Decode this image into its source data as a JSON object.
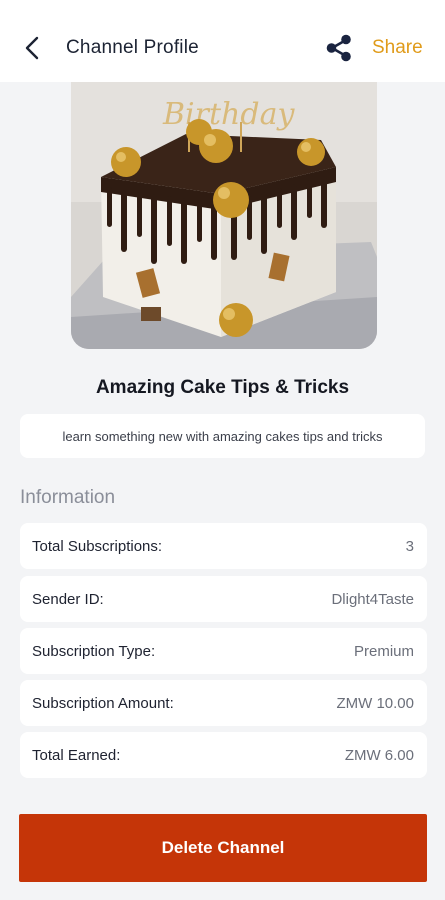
{
  "header": {
    "title": "Channel Profile",
    "share_label": "Share",
    "back_icon": "chevron-left-icon",
    "share_icon": "share-icon",
    "share_color": "#e09b1a"
  },
  "cover": {
    "topper_text": "Birthday",
    "icon": "cake-image"
  },
  "channel": {
    "title": "Amazing Cake Tips & Tricks",
    "description": "learn something new with amazing cakes tips and tricks"
  },
  "info": {
    "section_label": "Information",
    "rows": [
      {
        "key": "Total Subscriptions:",
        "value": "3"
      },
      {
        "key": "Sender ID:",
        "value": "Dlight4Taste"
      },
      {
        "key": "Subscription Type:",
        "value": "Premium"
      },
      {
        "key": "Subscription Amount:",
        "value": "ZMW 10.00"
      },
      {
        "key": "Total Earned:",
        "value": "ZMW 6.00"
      }
    ]
  },
  "actions": {
    "delete_label": "Delete Channel",
    "delete_color": "#c53508"
  }
}
